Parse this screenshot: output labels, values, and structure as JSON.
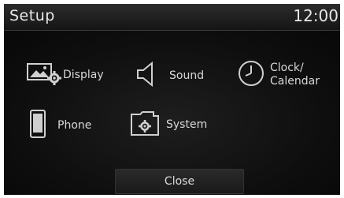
{
  "header": {
    "title": "Setup",
    "time": "12:00"
  },
  "menu": {
    "display": {
      "label": "Display",
      "icon": "display-settings-icon"
    },
    "sound": {
      "label": "Sound",
      "icon": "speaker-icon"
    },
    "clock": {
      "label_line1": "Clock/",
      "label_line2": "Calendar",
      "icon": "clock-icon"
    },
    "phone": {
      "label": "Phone",
      "icon": "phone-icon"
    },
    "system": {
      "label": "System",
      "icon": "system-folder-icon"
    }
  },
  "footer": {
    "close_label": "Close"
  },
  "colors": {
    "background": "#0c0c0c",
    "text": "#d8d8d8",
    "icon": "#d0d0d0"
  }
}
